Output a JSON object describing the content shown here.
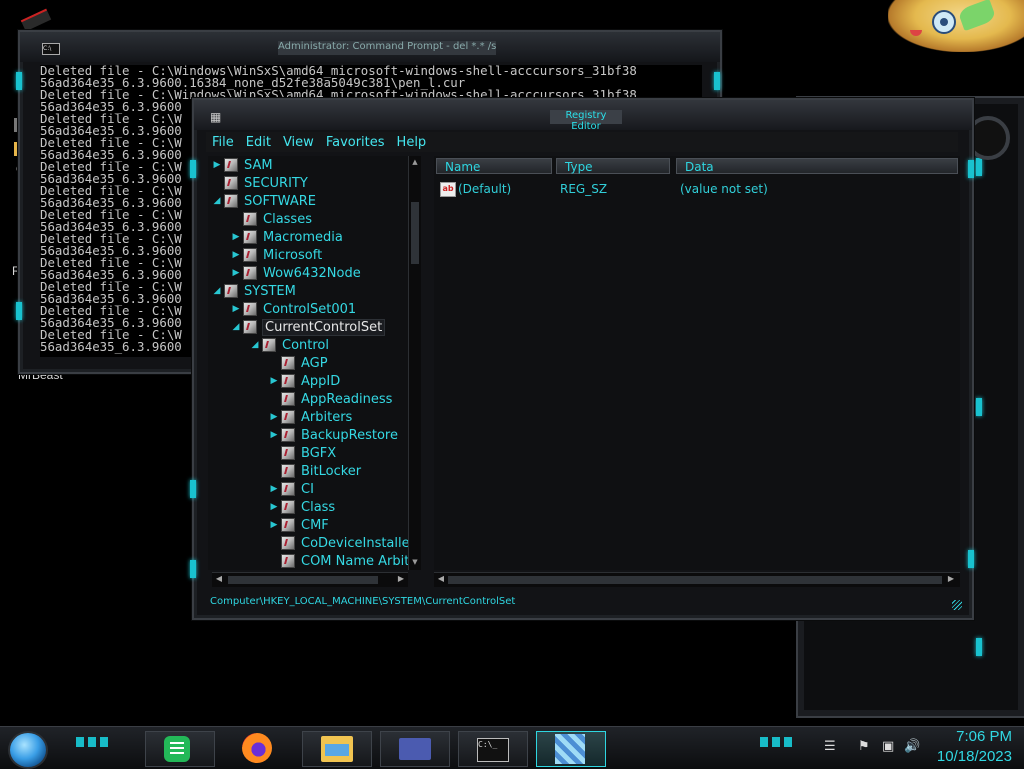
{
  "desktop": {
    "icon_labels": [
      "C",
      "Re",
      "MrBeast"
    ]
  },
  "cmd_window": {
    "title": "Administrator: Command Prompt - del  *.* /s /q",
    "icon": "C:\\",
    "lines": [
      "Deleted file - C:\\Windows\\WinSxS\\amd64_microsoft-windows-shell-acccursors_31bf38",
      "56ad364e35_6.3.9600.16384_none_d52fe38a5049c381\\pen_l.cur",
      "Deleted file - C:\\Windows\\WinSxS\\amd64_microsoft-windows-shell-acccursors_31bf38",
      "56ad364e35_6.3.9600",
      "Deleted file - C:\\W",
      "56ad364e35_6.3.9600",
      "Deleted file - C:\\W",
      "56ad364e35_6.3.9600",
      "Deleted file - C:\\W",
      "56ad364e35_6.3.9600",
      "Deleted file - C:\\W",
      "56ad364e35_6.3.9600",
      "Deleted file - C:\\W",
      "56ad364e35_6.3.9600",
      "Deleted file - C:\\W",
      "56ad364e35_6.3.9600",
      "Deleted file - C:\\W",
      "56ad364e35_6.3.9600",
      "Deleted file - C:\\W",
      "56ad364e35_6.3.9600",
      "Deleted file - C:\\W",
      "56ad364e35_6.3.9600",
      "Deleted file - C:\\W",
      "56ad364e35_6.3.9600"
    ]
  },
  "regedit": {
    "title": "Registry Editor",
    "menu": [
      "File",
      "Edit",
      "View",
      "Favorites",
      "Help"
    ],
    "tree": [
      {
        "label": "SAM",
        "expander": "▶",
        "level": 0
      },
      {
        "label": "SECURITY",
        "expander": "",
        "level": 0
      },
      {
        "label": "SOFTWARE",
        "expander": "◢",
        "level": 0
      },
      {
        "label": "Classes",
        "expander": "",
        "level": 1
      },
      {
        "label": "Macromedia",
        "expander": "▶",
        "level": 1
      },
      {
        "label": "Microsoft",
        "expander": "▶",
        "level": 1
      },
      {
        "label": "Wow6432Node",
        "expander": "▶",
        "level": 1
      },
      {
        "label": "SYSTEM",
        "expander": "◢",
        "level": 0
      },
      {
        "label": "ControlSet001",
        "expander": "▶",
        "level": 1
      },
      {
        "label": "CurrentControlSet",
        "expander": "◢",
        "level": 1,
        "selected": true
      },
      {
        "label": "Control",
        "expander": "◢",
        "level": 2
      },
      {
        "label": "AGP",
        "expander": "",
        "level": 3
      },
      {
        "label": "AppID",
        "expander": "▶",
        "level": 3
      },
      {
        "label": "AppReadiness",
        "expander": "",
        "level": 3
      },
      {
        "label": "Arbiters",
        "expander": "▶",
        "level": 3
      },
      {
        "label": "BackupRestore",
        "expander": "▶",
        "level": 3
      },
      {
        "label": "BGFX",
        "expander": "",
        "level": 3
      },
      {
        "label": "BitLocker",
        "expander": "",
        "level": 3
      },
      {
        "label": "CI",
        "expander": "▶",
        "level": 3
      },
      {
        "label": "Class",
        "expander": "▶",
        "level": 3
      },
      {
        "label": "CMF",
        "expander": "▶",
        "level": 3
      },
      {
        "label": "CoDeviceInstallers",
        "expander": "",
        "level": 3
      },
      {
        "label": "COM Name Arbiter",
        "expander": "",
        "level": 3
      }
    ],
    "columns": [
      "Name",
      "Type",
      "Data"
    ],
    "values": [
      {
        "icon": "ab",
        "name": "(Default)",
        "type": "REG_SZ",
        "data": "(value not set)"
      }
    ],
    "status_path": "Computer\\HKEY_LOCAL_MACHINE\\SYSTEM\\CurrentControlSet"
  },
  "taskbar": {
    "time": "7:06 PM",
    "date": "10/18/2023",
    "apps": [
      "sheets-app-icon",
      "firefox-icon",
      "file-explorer-icon",
      "wallet-card-icon",
      "command-prompt-icon",
      "registry-editor-icon"
    ],
    "active_app": "registry-editor-icon"
  },
  "colors": {
    "accent_cyan": "#2fd6e1",
    "background": "#000000",
    "frame": "#3a3e44"
  }
}
